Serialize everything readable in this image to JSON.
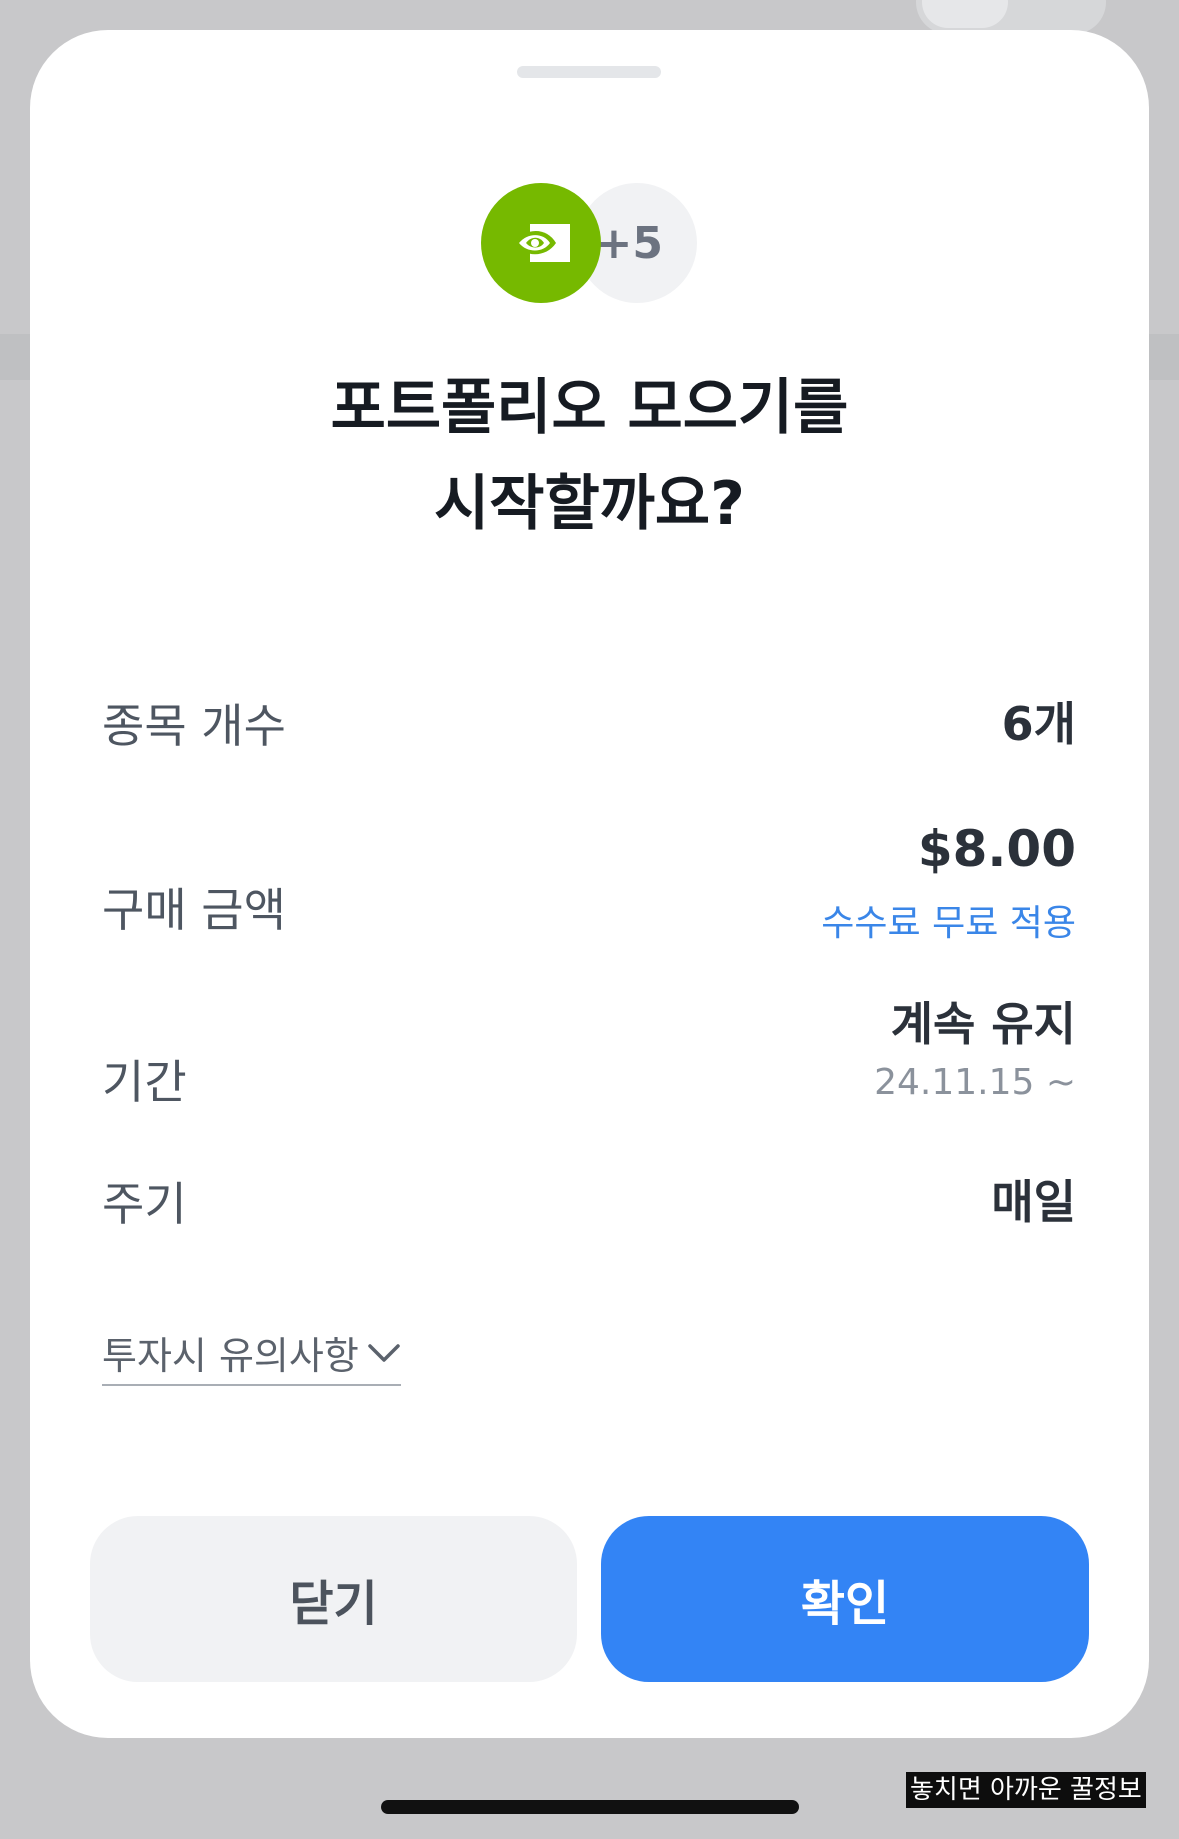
{
  "sheet": {
    "logo": {
      "primary_icon": "nvidia-logo-icon",
      "primary_color": "#76b900",
      "more_count": "+5"
    },
    "title_line1": "포트폴리오 모으기를",
    "title_line2": "시작할까요?",
    "rows": {
      "count": {
        "label": "종목 개수",
        "value": "6개"
      },
      "amount": {
        "label": "구매 금액",
        "value": "$8.00",
        "sub": "수수료 무료 적용"
      },
      "period": {
        "label": "기간",
        "value": "계속 유지",
        "sub": "24.11.15 ~"
      },
      "cycle": {
        "label": "주기",
        "value": "매일"
      }
    },
    "notice_label": "투자시 유의사항",
    "buttons": {
      "close": "닫기",
      "confirm": "확인"
    }
  },
  "colors": {
    "accent": "#3384f5",
    "link_blue": "#3a86e8",
    "dim_background": "#c8c8ca"
  },
  "watermark": "놓치면 아까운 꿀정보"
}
